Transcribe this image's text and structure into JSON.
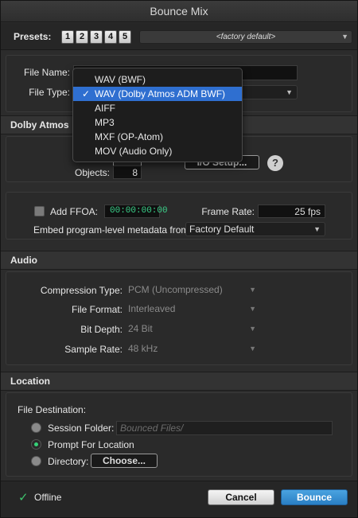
{
  "window": {
    "title": "Bounce Mix"
  },
  "presets": {
    "label": "Presets:",
    "buttons": [
      "1",
      "2",
      "3",
      "4",
      "5"
    ],
    "selected": "<factory default>"
  },
  "file": {
    "name_label": "File Name:",
    "name_value": "",
    "type_label": "File Type:",
    "type_menu": {
      "options": [
        "WAV (BWF)",
        "WAV (Dolby Atmos ADM BWF)",
        "AIFF",
        "MP3",
        "MXF (OP-Atom)",
        "MOV (Audio Only)"
      ],
      "selected_index": 1,
      "checkmark": "✓"
    }
  },
  "dolby_atmos": {
    "header": "Dolby Atmos",
    "objects_label": "Objects:",
    "objects_value": "8",
    "io_setup_label": "I/O Setup...",
    "help_label": "?",
    "add_ffoa_label": "Add FFOA:",
    "add_ffoa_checked": false,
    "ffoa_timecode": "00:00:00:00",
    "frame_rate_label": "Frame Rate:",
    "frame_rate_value": "25 fps",
    "embed_label": "Embed program-level metadata from:",
    "embed_value": "Factory Default"
  },
  "audio": {
    "header": "Audio",
    "compression_label": "Compression Type:",
    "compression_value": "PCM (Uncompressed)",
    "file_format_label": "File Format:",
    "file_format_value": "Interleaved",
    "bit_depth_label": "Bit Depth:",
    "bit_depth_value": "24 Bit",
    "sample_rate_label": "Sample Rate:",
    "sample_rate_value": "48 kHz"
  },
  "location": {
    "header": "Location",
    "destination_label": "File Destination:",
    "session_folder_label": "Session Folder:",
    "session_folder_placeholder": "Bounced Files/",
    "prompt_label": "Prompt For Location",
    "directory_label": "Directory:",
    "choose_label": "Choose...",
    "selected_option": "prompt"
  },
  "footer": {
    "offline_checked": true,
    "offline_label": "Offline",
    "cancel_label": "Cancel",
    "bounce_label": "Bounce"
  },
  "colors": {
    "accent_blue": "#2f6fd0",
    "timecode_green": "#3bd18a",
    "radio_green": "#36d178"
  }
}
